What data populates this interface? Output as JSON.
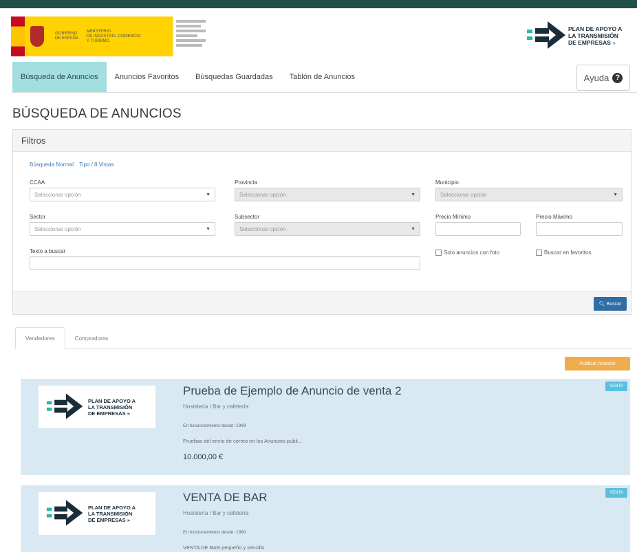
{
  "brand": {
    "line1": "PLAN DE APOYO A",
    "line2": "LA TRANSMISIÓN",
    "line3": "DE EMPRESAS",
    "line3_mark": "»"
  },
  "nav": {
    "tabs": [
      {
        "label": "Búsqueda de Anuncios",
        "active": true
      },
      {
        "label": "Anuncios Favoritos",
        "active": false
      },
      {
        "label": "Búsquedas Guardadas",
        "active": false
      },
      {
        "label": "Tablón de Anuncios",
        "active": false
      }
    ],
    "help_label": "Ayuda",
    "help_glyph": "?"
  },
  "page_title": "BÚSQUEDA DE ANUNCIOS",
  "filters": {
    "panel_title": "Filtros",
    "links": [
      "Búsqueda Normal",
      "Tipo / 8 Vistas"
    ],
    "ccaa": {
      "label": "CCAA",
      "placeholder": "Seleccionar opción"
    },
    "provincia": {
      "label": "Provincia",
      "placeholder": "Seleccionar opción"
    },
    "municipio": {
      "label": "Municipio",
      "placeholder": "Seleccionar opción"
    },
    "sector": {
      "label": "Sector",
      "placeholder": "Seleccionar opción"
    },
    "subsector": {
      "label": "Subsector",
      "placeholder": "Seleccionar opción"
    },
    "precio_min": {
      "label": "Precio Mínimo",
      "value": ""
    },
    "precio_max": {
      "label": "Precio Máximo",
      "value": ""
    },
    "texto": {
      "label": "Texto a buscar",
      "value": ""
    },
    "solo_foto": "Solo anuncios con foto",
    "buscar_favoritos": "Buscar en favoritos",
    "search_button": "Buscar"
  },
  "results": {
    "tabs": [
      "Vendedores",
      "Compradores"
    ],
    "action_button": "Publicar Anuncio",
    "cards": [
      {
        "title": "Prueba de Ejemplo de Anuncio de venta 2",
        "category": "Hostelería / Bar y cafetería",
        "since": "En funcionamiento desde: 1999",
        "desc": "Pruebas del envío de correo en los Anuncios publi...",
        "price": "10.000,00 €",
        "badge": "VENTA"
      },
      {
        "title": "VENTA DE BAR",
        "category": "Hostelería / Bar y cafetería",
        "since": "En funcionamiento desde: 1990",
        "desc": "VENTA DE BAR pequeño y sencillo",
        "price": "",
        "badge": "VENTA"
      }
    ]
  },
  "colors": {
    "topbar": "#1f4f46",
    "nav_active": "#a3dfe0",
    "primary": "#2f6da6",
    "orange": "#f0ad4e",
    "card_bg": "#d8e9f3",
    "badge": "#5bc0de"
  }
}
